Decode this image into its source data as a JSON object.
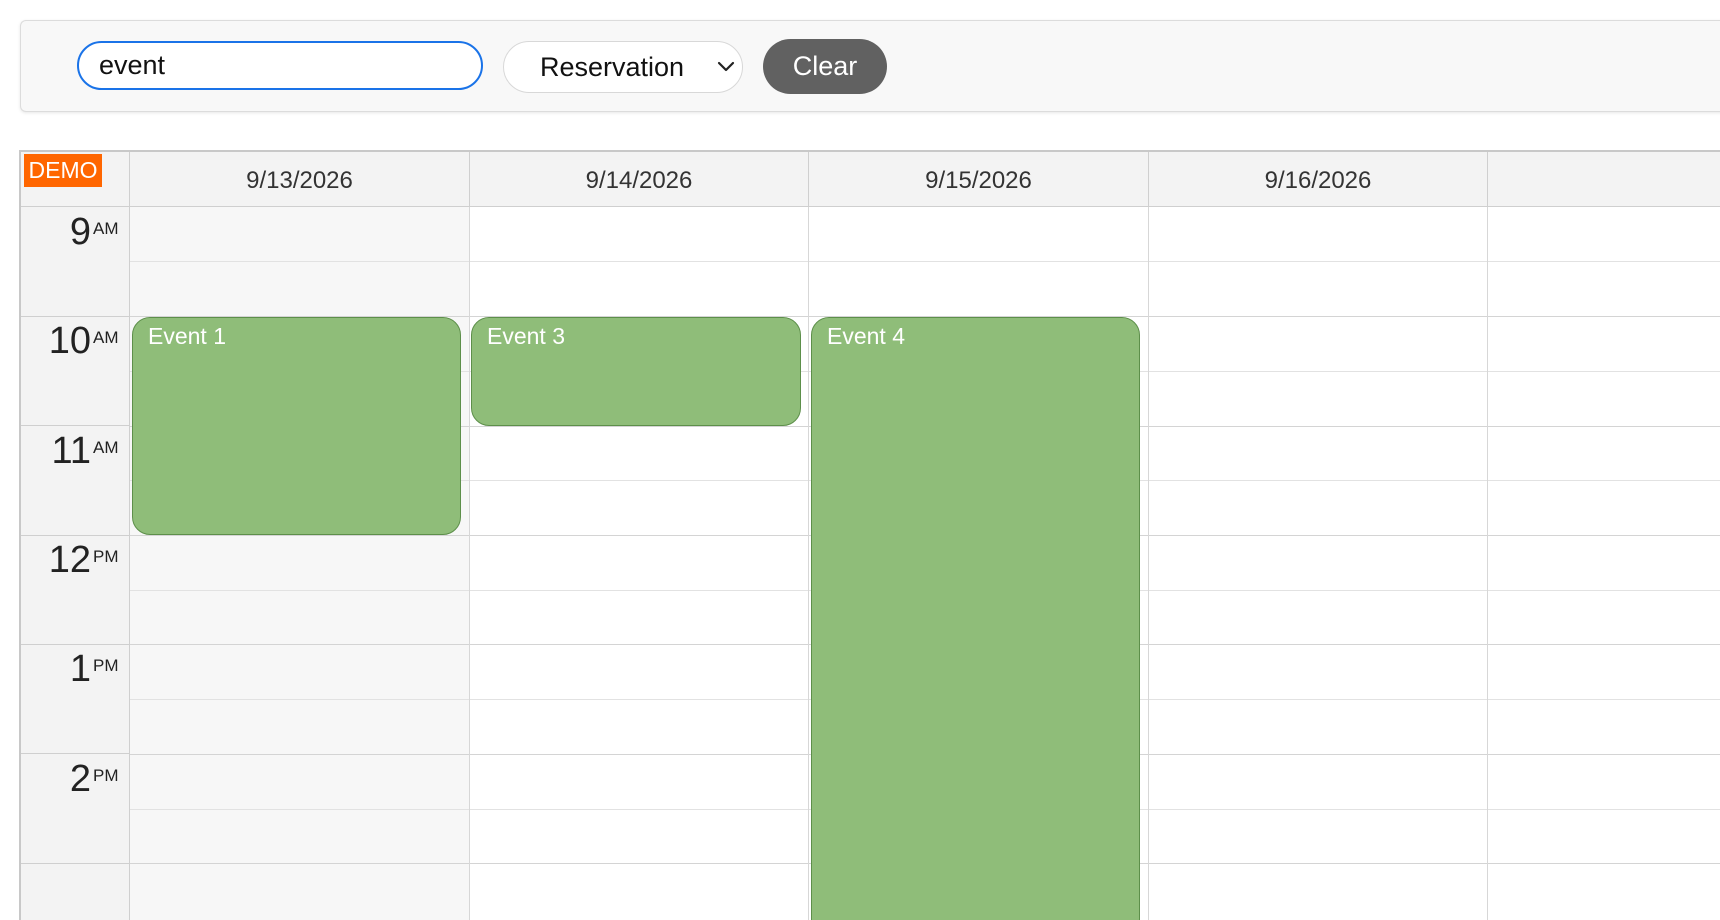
{
  "toolbar": {
    "search_value": "event",
    "filter_selected": "Reservation",
    "clear_label": "Clear"
  },
  "calendar": {
    "badge": "DEMO",
    "days": [
      "9/13/2026",
      "9/14/2026",
      "9/15/2026",
      "9/16/2026"
    ],
    "hours": [
      {
        "num": "9",
        "ampm": "AM"
      },
      {
        "num": "10",
        "ampm": "AM"
      },
      {
        "num": "11",
        "ampm": "AM"
      },
      {
        "num": "12",
        "ampm": "PM"
      },
      {
        "num": "1",
        "ampm": "PM"
      },
      {
        "num": "2",
        "ampm": "PM"
      }
    ],
    "events": [
      {
        "label": "Event 1",
        "day": "9/13/2026"
      },
      {
        "label": "Event 3",
        "day": "9/14/2026"
      },
      {
        "label": "Event 4",
        "day": "9/15/2026"
      }
    ]
  },
  "colors": {
    "event_fill": "#8fbd79",
    "event_border": "#5d8f4a",
    "demo_badge": "#ff6600",
    "clear_button": "#616161",
    "search_focus": "#1a73e8"
  }
}
